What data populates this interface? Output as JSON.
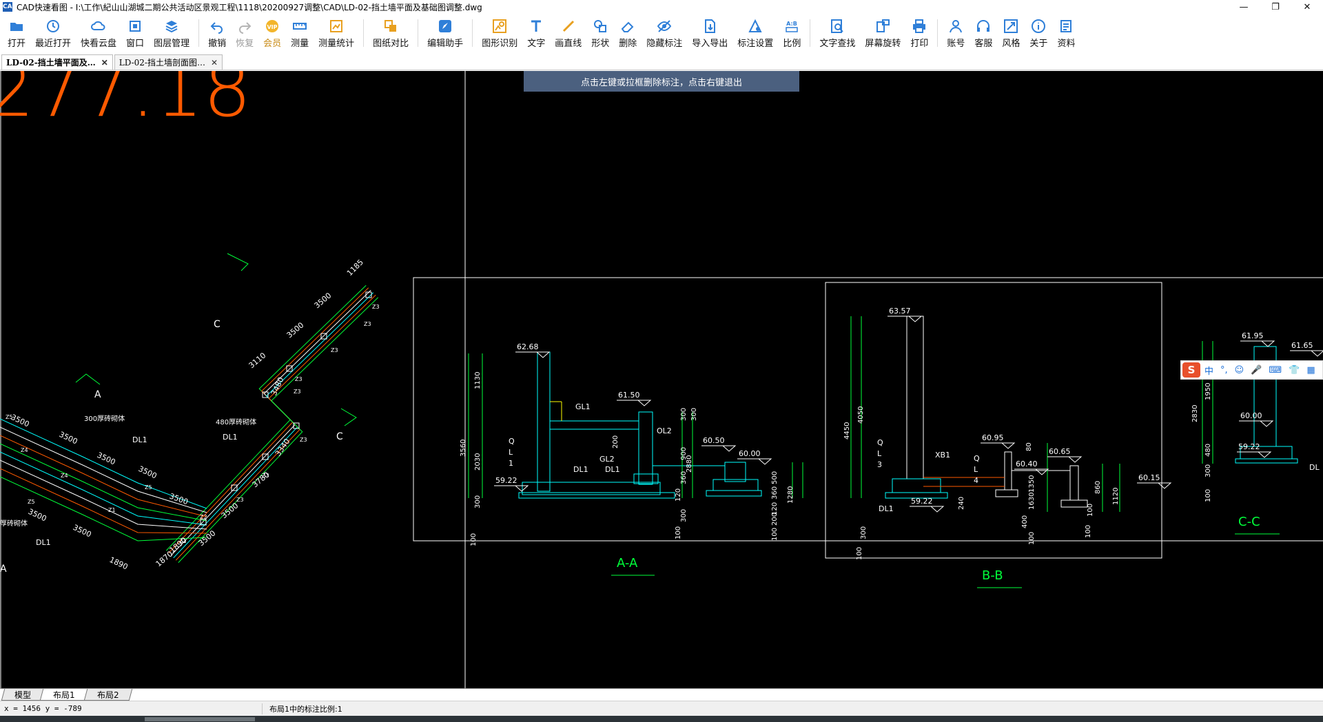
{
  "window": {
    "title": "CAD快速看图 - I:\\工作\\紀山山湖城二期公共活动区景观工程\\1118\\20200927调整\\CAD\\LD-02-挡土墙平面及基础图调整.dwg",
    "icon_text": "CAD",
    "controls": [
      "minimize-icon",
      "restore-icon",
      "close-icon"
    ]
  },
  "toolbar": {
    "groups": [
      [
        {
          "label": "打开",
          "icon": "folder-open-icon"
        },
        {
          "label": "最近打开",
          "icon": "recent-icon"
        },
        {
          "label": "快看云盘",
          "icon": "cloud-icon"
        },
        {
          "label": "窗口",
          "icon": "window-icon"
        },
        {
          "label": "图层管理",
          "icon": "layers-icon"
        }
      ],
      [
        {
          "label": "撤销",
          "icon": "undo-icon"
        },
        {
          "label": "恢复",
          "icon": "redo-icon",
          "disabled": true
        },
        {
          "label": "会员",
          "icon": "vip-icon",
          "vip": true
        },
        {
          "label": "测量",
          "icon": "measure-icon"
        },
        {
          "label": "测量统计",
          "icon": "measure-stats-icon"
        }
      ],
      [
        {
          "label": "图纸对比",
          "icon": "compare-icon"
        }
      ],
      [
        {
          "label": "编辑助手",
          "icon": "edit-assistant-icon"
        }
      ],
      [
        {
          "label": "图形识别",
          "icon": "shape-recognize-icon"
        },
        {
          "label": "文字",
          "icon": "text-icon"
        },
        {
          "label": "画直线",
          "icon": "line-icon"
        },
        {
          "label": "形状",
          "icon": "shape-icon"
        },
        {
          "label": "删除",
          "icon": "eraser-icon"
        },
        {
          "label": "隐藏标注",
          "icon": "hide-annotation-icon"
        },
        {
          "label": "导入导出",
          "icon": "import-export-icon"
        },
        {
          "label": "标注设置",
          "icon": "annotation-settings-icon"
        },
        {
          "label": "比例",
          "icon": "scale-icon"
        }
      ],
      [
        {
          "label": "文字查找",
          "icon": "text-search-icon"
        },
        {
          "label": "屏幕旋转",
          "icon": "rotate-screen-icon"
        },
        {
          "label": "打印",
          "icon": "print-icon"
        }
      ],
      [
        {
          "label": "账号",
          "icon": "account-icon"
        },
        {
          "label": "客服",
          "icon": "headset-icon"
        },
        {
          "label": "风格",
          "icon": "style-icon"
        },
        {
          "label": "关于",
          "icon": "info-icon"
        },
        {
          "label": "资料",
          "icon": "resources-icon"
        }
      ]
    ]
  },
  "doc_tabs": [
    {
      "label": "LD-02-挡土墙平面及…",
      "active": true
    },
    {
      "label": "LD-02-挡土墙剖面图…",
      "active": false
    }
  ],
  "canvas": {
    "hint": "点击左键或拉框删除标注，点击右键退出",
    "big_text": "277.18",
    "plan_labels": {
      "dims": [
        "1185",
        "3500",
        "3500",
        "3110",
        "3480",
        "3340",
        "3780",
        "3500",
        "3500",
        "1890",
        "1870",
        "3500",
        "3500",
        "3500",
        "3500",
        "3500",
        "3500",
        "3500",
        "1890"
      ],
      "z_tags": [
        "Z3",
        "Z3",
        "Z3",
        "Z3",
        "Z3",
        "Z3",
        "Z3",
        "Z3",
        "Z2",
        "Z1",
        "Z1",
        "Z5",
        "Z5",
        "Z4",
        "Z4",
        "Z5"
      ],
      "wall_notes": [
        "300厚砖砌体",
        "480厚砖砌体",
        "厚砖砌体"
      ],
      "dl": [
        "DL1",
        "DL1",
        "DL1"
      ],
      "section_marks": [
        "A",
        "A",
        "C",
        "C"
      ]
    },
    "section_aa": {
      "title": "A-A",
      "elev": [
        "62.68",
        "61.50",
        "60.50",
        "60.00",
        "59.22"
      ],
      "labels": [
        "GL1",
        "GL2",
        "DL1",
        "DL1",
        "OL2",
        "Q",
        "L",
        "1"
      ],
      "dims_left": [
        "1130",
        "2030",
        "3560",
        "300",
        "100"
      ],
      "dims_mid": [
        "200",
        "300",
        "300",
        "2880",
        "900",
        "360",
        "120",
        "300",
        "100"
      ],
      "dims_right": [
        "500",
        "1280",
        "360",
        "120",
        "200",
        "100"
      ]
    },
    "section_bb": {
      "title": "B-B",
      "elev": [
        "63.57",
        "60.95",
        "60.40",
        "60.65",
        "60.15",
        "59.22"
      ],
      "labels": [
        "XB1",
        "DL1",
        "Q",
        "L",
        "3",
        "Q",
        "L",
        "4"
      ],
      "dims": [
        "4450",
        "4050",
        "300",
        "100",
        "80",
        "240",
        "1350",
        "1630",
        "400",
        "100",
        "860",
        "1120",
        "100",
        "100"
      ]
    },
    "section_cc": {
      "title": "C-C",
      "elev": [
        "61.95",
        "61.65",
        "60.00",
        "59.22"
      ],
      "labels": [
        "DL"
      ],
      "dims": [
        "1950",
        "2830",
        "480",
        "300",
        "100"
      ]
    }
  },
  "ime_bar": {
    "logo": "S",
    "items": [
      "中",
      "°,",
      "☺",
      "🎤",
      "⌨",
      "👕",
      "▦"
    ]
  },
  "layout_tabs": [
    {
      "label": "模型",
      "active": false
    },
    {
      "label": "布局1",
      "active": true
    },
    {
      "label": "布局2",
      "active": false
    }
  ],
  "status": {
    "coords": "x = 1456  y = -789",
    "scale_text": "布局1中的标注比例:1"
  },
  "colors": {
    "canvas_bg": "#000000",
    "hint_bg": "#4b607f",
    "cad_green": "#00ff3a",
    "cad_cyan": "#00ffff",
    "cad_yellow": "#ffff00",
    "cad_orange": "#ff5a00",
    "cad_white": "#ffffff"
  }
}
